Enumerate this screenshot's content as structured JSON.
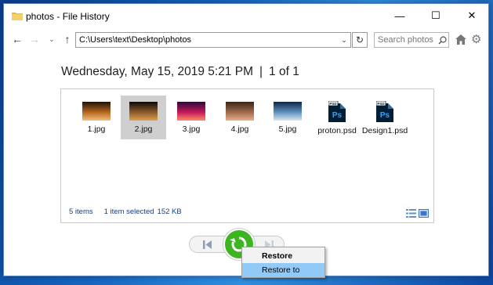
{
  "window": {
    "title": "photos - File History",
    "minimize": "—",
    "maximize": "☐",
    "close": "✕"
  },
  "nav": {
    "back": "←",
    "forward": "→",
    "recent": "⌄",
    "up": "↑",
    "address": "C:\\Users\\text\\Desktop\\photos",
    "address_dropdown": "⌄",
    "refresh": "↻",
    "search_placeholder": "Search photos"
  },
  "header": {
    "date": "Wednesday, May 15, 2019 5:21 PM",
    "separator": "|",
    "position": "1 of 1"
  },
  "files": [
    {
      "name": "1.jpg",
      "kind": "jpg",
      "thumb": [
        "#1d1308",
        "#b5651d",
        "#f0c080"
      ],
      "selected": false
    },
    {
      "name": "2.jpg",
      "kind": "jpg",
      "thumb": [
        "#0e0b08",
        "#8a5a2b",
        "#e0a050"
      ],
      "selected": true
    },
    {
      "name": "3.jpg",
      "kind": "jpg",
      "thumb": [
        "#2a0a3a",
        "#c2185b",
        "#ff8a65"
      ],
      "selected": false
    },
    {
      "name": "4.jpg",
      "kind": "jpg",
      "thumb": [
        "#3a2418",
        "#9e6a4a",
        "#e8b090"
      ],
      "selected": false
    },
    {
      "name": "5.jpg",
      "kind": "jpg",
      "thumb": [
        "#0d2744",
        "#5e8fc0",
        "#dbe6f0"
      ],
      "selected": false
    },
    {
      "name": "proton.psd",
      "kind": "psd",
      "selected": false
    },
    {
      "name": "Design1.psd",
      "kind": "psd",
      "selected": false
    }
  ],
  "status": {
    "count": "5 items",
    "selection": "1 item selected",
    "size": "152 KB"
  },
  "psd_badge": "PSD",
  "psd_glyph": "Ps",
  "context_menu": {
    "items": [
      "Restore",
      "Restore to"
    ]
  },
  "colors": {
    "restore_green": "#3cb521",
    "psd_blue": "#001e36",
    "psd_text": "#31a8ff",
    "menu_highlight": "#91c9f7"
  }
}
